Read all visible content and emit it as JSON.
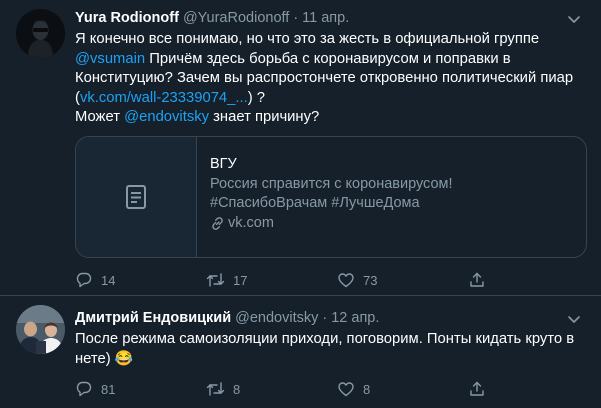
{
  "tweets": [
    {
      "author_name": "Yura Rodionoff",
      "handle": "@YuraRodionoff",
      "date": "11 апр.",
      "body": {
        "line1": "Я конечно все понимаю, но что это за жесть в официальной группе",
        "mention1": "@vsumain",
        "line2": " Причём здесь борьба с коронавирусом и поправки в Конституцию? Зачем вы распростончете откровенно политический пиар (",
        "link": "vk.com/wall-23339074_...",
        "line3": ") ?",
        "line4": "Может ",
        "mention2": "@endovitsky",
        "line5": " знает причину?"
      },
      "card": {
        "title": "ВГУ",
        "description_1": "Россия справится с коронавирусом!",
        "description_2": "#СпасибоВрачам #ЛучшеДома",
        "domain": "vk.com"
      },
      "actions": {
        "replies": "14",
        "retweets": "17",
        "likes": "73"
      }
    },
    {
      "author_name": "Дмитрий Ендовицкий",
      "handle": "@endovitsky",
      "date": "12 апр.",
      "body": {
        "text": "После режима самоизоляции приходи, поговорим. Понты кидать круто в нете) 😂"
      },
      "actions": {
        "replies": "81",
        "retweets": "8",
        "likes": "8"
      }
    }
  ],
  "dot": "·"
}
